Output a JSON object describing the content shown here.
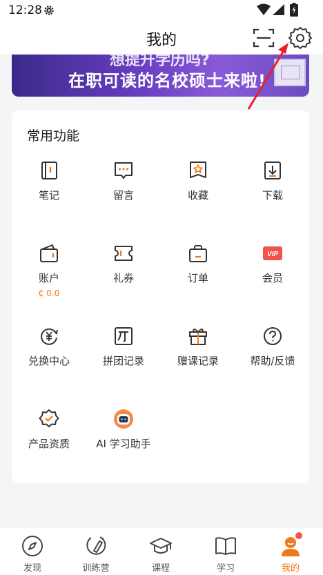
{
  "status_bar": {
    "time": "12:28"
  },
  "header": {
    "title": "我的"
  },
  "banner": {
    "line1": "想提升学历吗?",
    "line2": "在职可读的名校硕士来啦!"
  },
  "functions": {
    "title": "常用功能",
    "items": [
      {
        "label": "笔记",
        "icon": "notebook-icon"
      },
      {
        "label": "留言",
        "icon": "message-icon"
      },
      {
        "label": "收藏",
        "icon": "bookmark-star-icon"
      },
      {
        "label": "下载",
        "icon": "download-icon"
      },
      {
        "label": "账户",
        "icon": "wallet-icon",
        "sub": "₵ 0.0"
      },
      {
        "label": "礼券",
        "icon": "coupon-icon"
      },
      {
        "label": "订单",
        "icon": "bag-icon"
      },
      {
        "label": "会员",
        "icon": "vip-icon"
      },
      {
        "label": "兑换中心",
        "icon": "exchange-icon"
      },
      {
        "label": "拼团记录",
        "icon": "group-buy-icon"
      },
      {
        "label": "赠课记录",
        "icon": "gift-icon"
      },
      {
        "label": "帮助/反馈",
        "icon": "help-icon"
      },
      {
        "label": "产品资质",
        "icon": "certified-badge-icon"
      },
      {
        "label": "AI 学习助手",
        "icon": "robot-assistant-icon"
      }
    ]
  },
  "tabs": [
    {
      "label": "发现",
      "icon": "compass-icon"
    },
    {
      "label": "训练营",
      "icon": "training-icon"
    },
    {
      "label": "课程",
      "icon": "graduation-cap-icon"
    },
    {
      "label": "学习",
      "icon": "book-icon"
    },
    {
      "label": "我的",
      "icon": "profile-icon",
      "active": true
    }
  ],
  "colors": {
    "accent": "#f07a1a",
    "vip": "#f0544a",
    "annotation_arrow": "#e8202a"
  }
}
